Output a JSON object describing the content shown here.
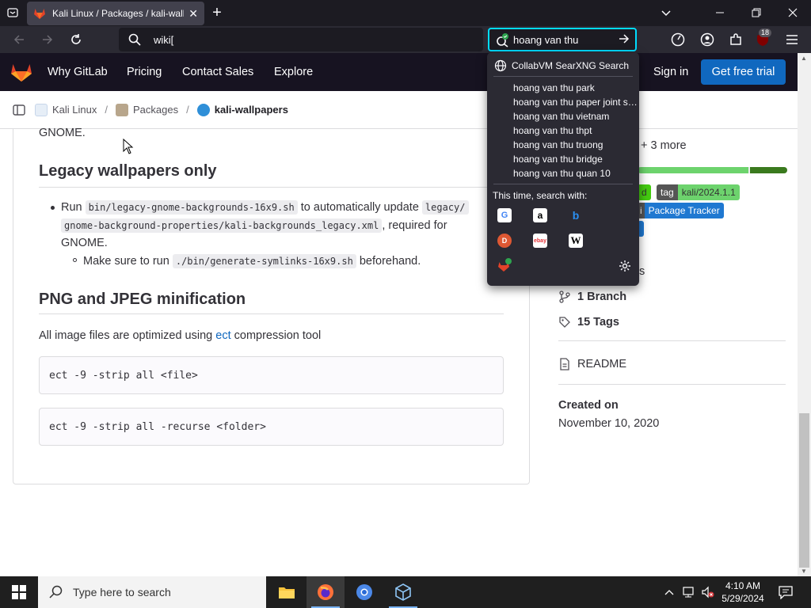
{
  "browser": {
    "tab_title": "Kali Linux / Packages / kali-wallpapers",
    "url_text": "wiki[",
    "search_value": "hoang van thu",
    "toolbar_badge": "18"
  },
  "gitlab": {
    "nav": [
      "Why GitLab",
      "Pricing",
      "Contact Sales",
      "Explore"
    ],
    "sign_in": "Sign in",
    "trial": "Get free trial"
  },
  "breadcrumb": {
    "items": [
      "Kali Linux",
      "Packages",
      "kali-wallpapers"
    ],
    "separator": "/"
  },
  "content": {
    "gnome_tail": "GNOME.",
    "h_legacy": "Legacy wallpapers only",
    "b1_run": "Run",
    "b1_code1": "bin/legacy-gnome-backgrounds-16x9.sh",
    "b1_mid": "to automatically update",
    "b1_code2": "legacy/",
    "b1_code3": "gnome-background-properties/kali-backgrounds_legacy.xml",
    "b1_end": ", required for",
    "b1_gnome": "GNOME.",
    "b2_pre": "Make sure to run",
    "b2_code": "./bin/generate-symlinks-16x9.sh",
    "b2_post": "beforehand.",
    "h_png": "PNG and JPEG minification",
    "p_pre": "All image files are optimized using",
    "p_link": "ect",
    "p_post": "compression tool",
    "code1": "ect -9 -strip all <file>",
    "code2": "ect -9 -strip all -recurse <folder>"
  },
  "sidebar": {
    "more": "+ 3 more",
    "badge_tag_key": "tag",
    "badge_tag_val": "kali/2024.1.1",
    "badge_partial": "d",
    "badge_tracker": "Package Tracker",
    "tracker_prefix": "i",
    "partial_s": "s",
    "branches": "1 Branch",
    "tags": "15 Tags",
    "readme": "README",
    "created_label": "Created on",
    "created_date": "November 10, 2020",
    "language_bar": [
      0.75,
      0.25
    ],
    "colors": {
      "lang1": "#6dd36d",
      "lang2": "#3a7a1e",
      "badge_green": "#4c1",
      "badge_blue": "#1f78d1"
    }
  },
  "search_dropdown": {
    "engine_name": "CollabVM SearXNG Search",
    "suggestions": [
      "hoang van thu park",
      "hoang van thu paper joint stock",
      "hoang van thu vietnam",
      "hoang van thu thpt",
      "hoang van thu truong",
      "hoang van thu bridge",
      "hoang van thu quan 10"
    ],
    "this_time_label": "This time, search with:",
    "engines": [
      "google-icon",
      "amazon-icon",
      "bing-icon",
      "duckduckgo-icon",
      "ebay-icon",
      "wikipedia-icon",
      "searxng-icon"
    ]
  },
  "taskbar": {
    "search_placeholder": "Type here to search",
    "time": "4:10 AM",
    "date": "5/29/2024"
  }
}
